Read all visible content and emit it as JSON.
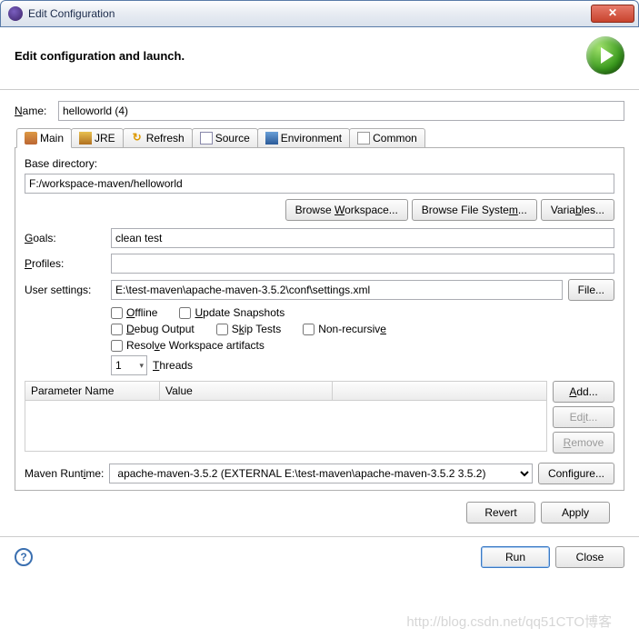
{
  "window": {
    "title": "Edit Configuration"
  },
  "header": {
    "title": "Edit configuration and launch."
  },
  "name": {
    "label": "Name:",
    "value": "helloworld (4)"
  },
  "tabs": [
    {
      "label": "Main"
    },
    {
      "label": "JRE"
    },
    {
      "label": "Refresh"
    },
    {
      "label": "Source"
    },
    {
      "label": "Environment"
    },
    {
      "label": "Common"
    }
  ],
  "panel": {
    "base_dir_label": "Base directory:",
    "base_dir_value": "F:/workspace-maven/helloworld",
    "browse_ws": "Browse Workspace...",
    "browse_fs": "Browse File System...",
    "variables": "Variables...",
    "goals_label": "Goals:",
    "goals_value": "clean test",
    "profiles_label": "Profiles:",
    "profiles_value": "",
    "user_settings_label": "User settings:",
    "user_settings_value": "E:\\test-maven\\apache-maven-3.5.2\\conf\\settings.xml",
    "file_btn": "File...",
    "offline": "Offline",
    "update_snapshots": "Update Snapshots",
    "debug_output": "Debug Output",
    "skip_tests": "Skip Tests",
    "non_recursive": "Non-recursive",
    "resolve_ws": "Resolve Workspace artifacts",
    "threads_value": "1",
    "threads_label": "Threads",
    "table": {
      "col1": "Parameter Name",
      "col2": "Value",
      "add": "Add...",
      "edit": "Edit...",
      "remove": "Remove"
    },
    "runtime_label": "Maven Runtime:",
    "runtime_value": "apache-maven-3.5.2 (EXTERNAL E:\\test-maven\\apache-maven-3.5.2 3.5.2)",
    "configure": "Configure..."
  },
  "footer": {
    "revert": "Revert",
    "apply": "Apply",
    "run": "Run",
    "close": "Close"
  }
}
